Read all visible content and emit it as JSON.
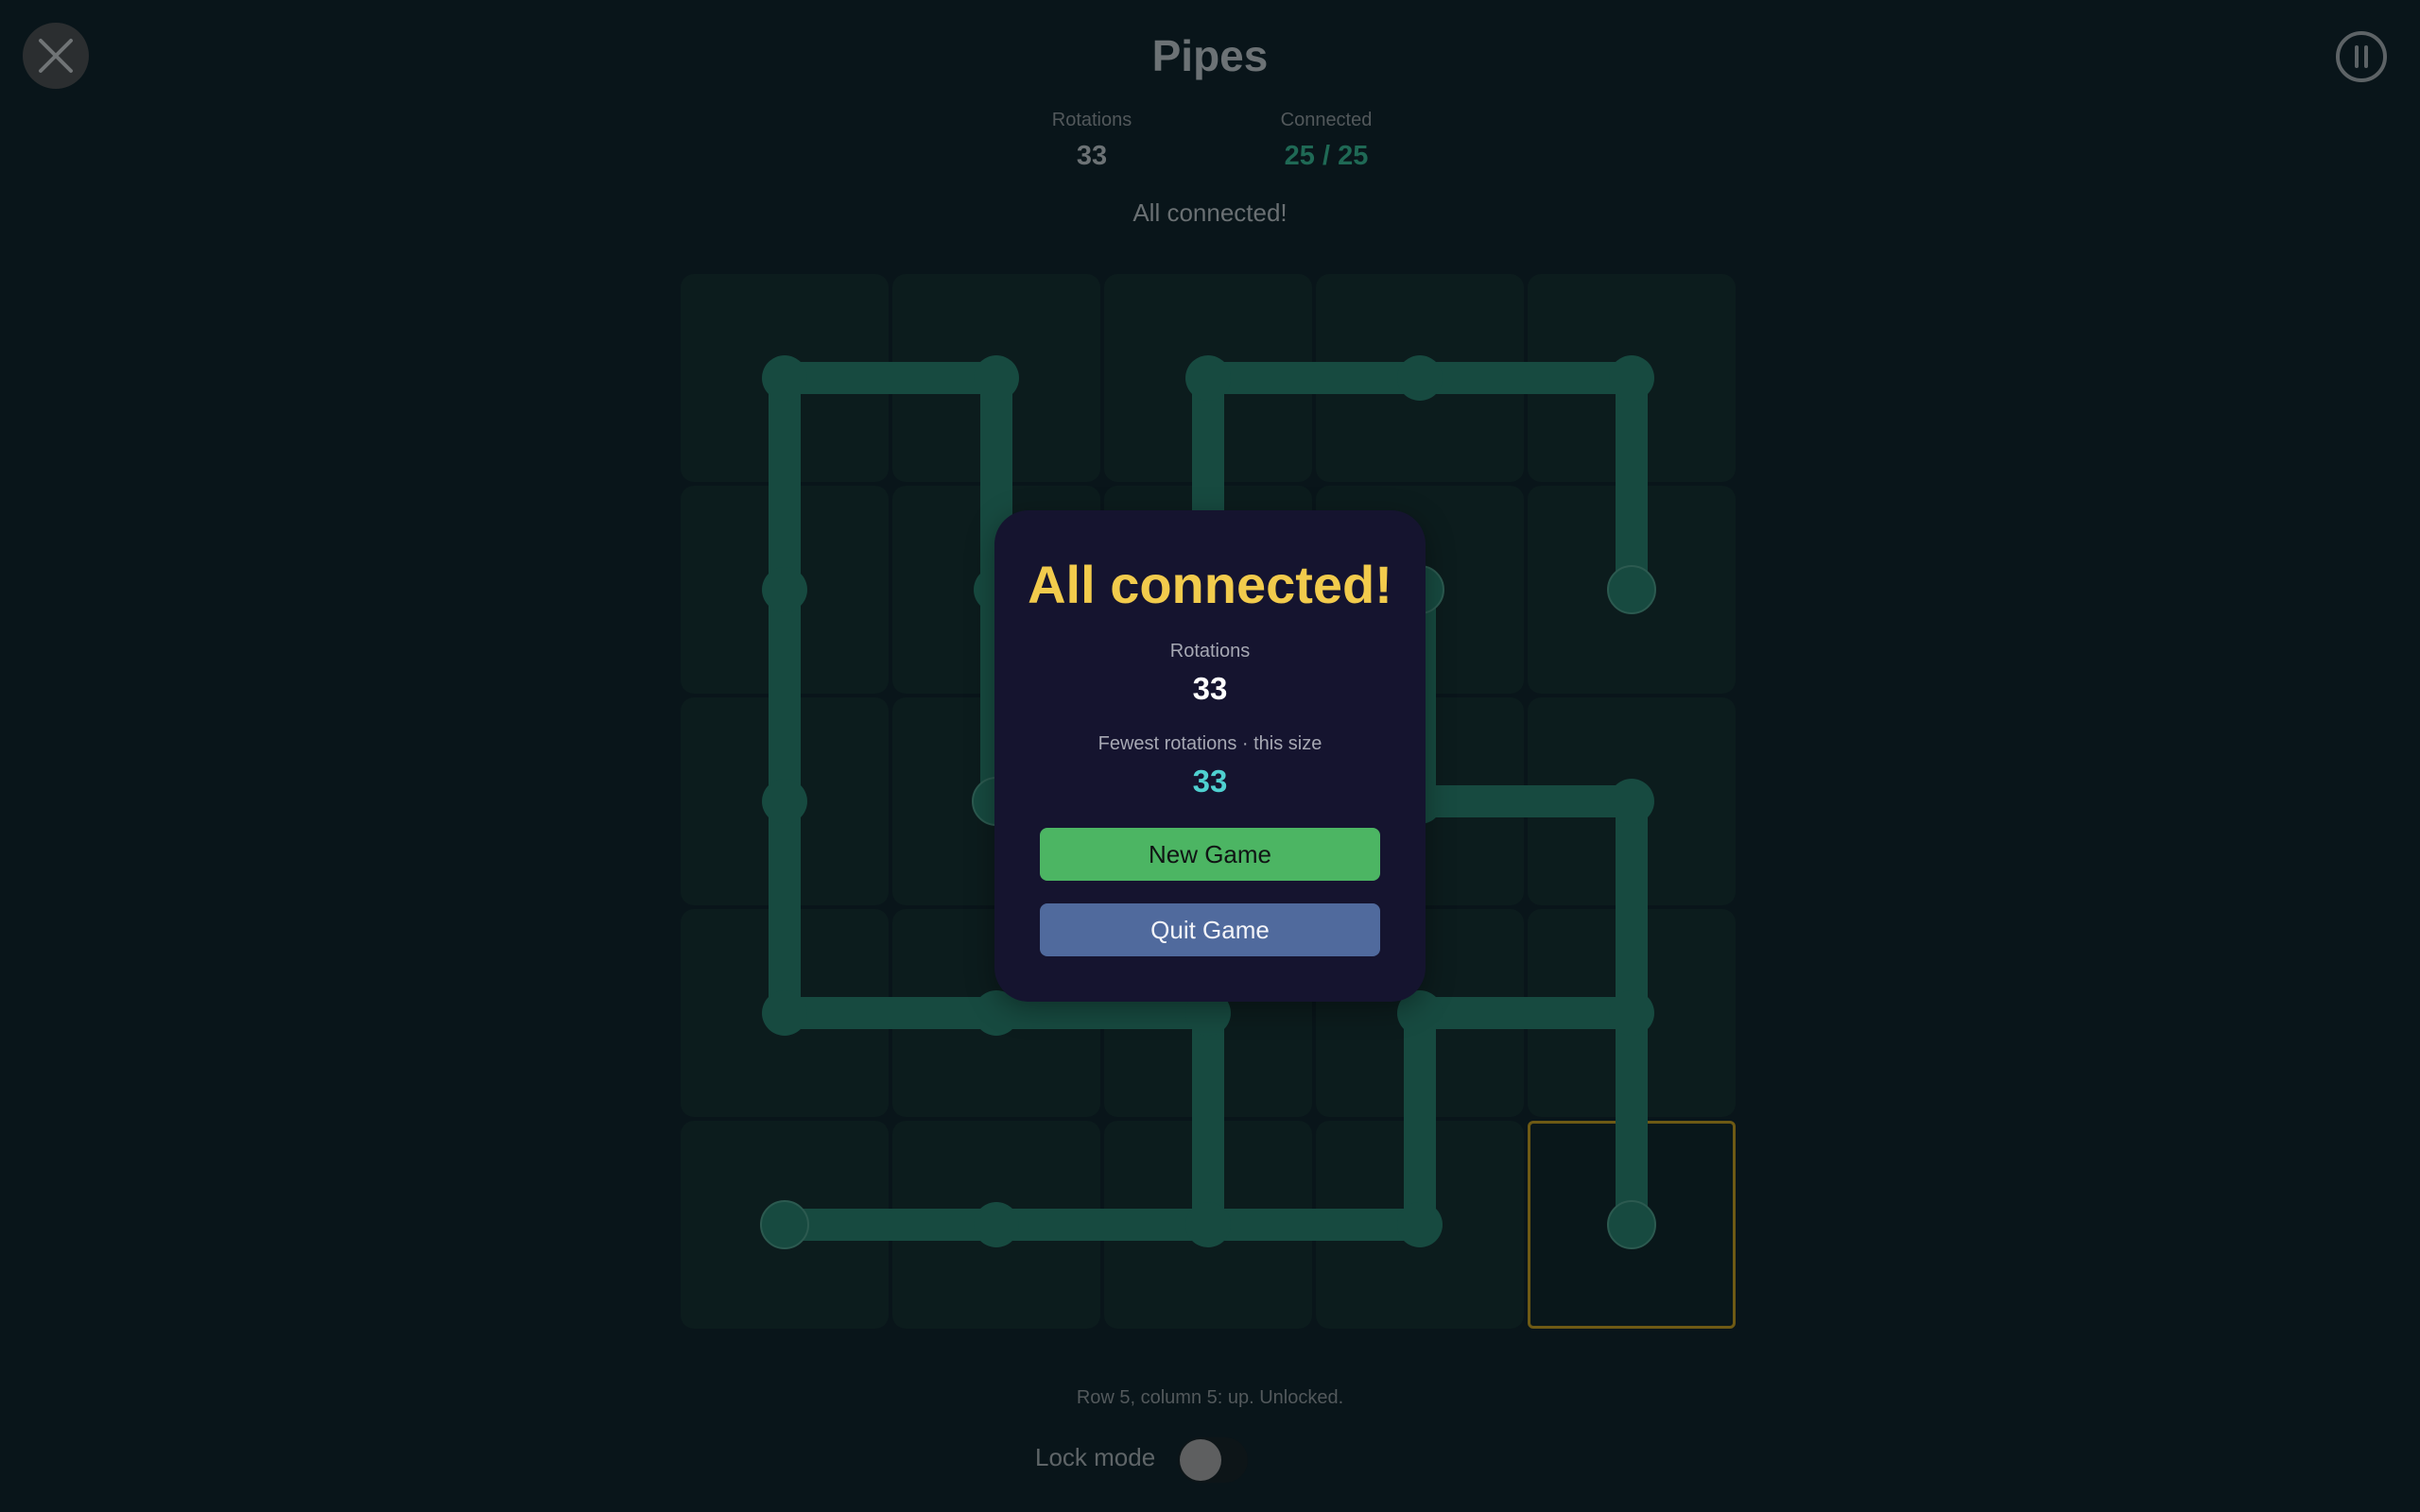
{
  "header": {
    "title": "Pipes",
    "rotations_label": "Rotations",
    "rotations_value": "33",
    "connected_label": "Connected",
    "connected_value": "25 / 25",
    "status": "All connected!"
  },
  "board": {
    "rows": 5,
    "cols": 5,
    "selected_cell": {
      "row": 5,
      "col": 5
    },
    "connected": true,
    "pipe_color": "#174a40",
    "cell_color": "#0c1c1d",
    "selected_outline_color": "#6e5a14",
    "cells": [
      [
        {
          "dirs": [
            "right",
            "down"
          ]
        },
        {
          "dirs": [
            "left",
            "down"
          ]
        },
        {
          "dirs": [
            "right",
            "down"
          ]
        },
        {
          "dirs": [
            "left",
            "right"
          ]
        },
        {
          "dirs": [
            "left",
            "down"
          ]
        }
      ],
      [
        {
          "dirs": [
            "up",
            "down"
          ]
        },
        {
          "dirs": [
            "up",
            "down"
          ]
        },
        {
          "dirs": [
            "up",
            "down"
          ]
        },
        {
          "dirs": [
            "down"
          ]
        },
        {
          "dirs": [
            "up"
          ]
        }
      ],
      [
        {
          "dirs": [
            "up",
            "down"
          ]
        },
        {
          "dirs": [
            "up"
          ]
        },
        {
          "dirs": [
            "up",
            "down"
          ]
        },
        {
          "dirs": [
            "up",
            "right"
          ]
        },
        {
          "dirs": [
            "left",
            "down"
          ]
        }
      ],
      [
        {
          "dirs": [
            "up",
            "right"
          ]
        },
        {
          "dirs": [
            "left",
            "right"
          ]
        },
        {
          "dirs": [
            "left",
            "down"
          ]
        },
        {
          "dirs": [
            "right",
            "down"
          ]
        },
        {
          "dirs": [
            "up",
            "left",
            "down"
          ]
        }
      ],
      [
        {
          "dirs": [
            "right"
          ]
        },
        {
          "dirs": [
            "left",
            "right"
          ]
        },
        {
          "dirs": [
            "up",
            "left",
            "right"
          ]
        },
        {
          "dirs": [
            "up",
            "left"
          ]
        },
        {
          "dirs": [
            "up"
          ]
        }
      ]
    ]
  },
  "footer": {
    "cell_info": "Row 5, column 5: up. Unlocked.",
    "lock_mode_label": "Lock mode",
    "lock_mode_on": false
  },
  "modal": {
    "title": "All connected!",
    "rotations_label": "Rotations",
    "rotations_value": "33",
    "best_label": "Fewest rotations · this size",
    "best_value": "33",
    "new_game_label": "New Game",
    "quit_game_label": "Quit Game",
    "title_color": "#f2cb4c",
    "best_color": "#4fd0d0"
  },
  "icons": {
    "close": "close-icon",
    "pause": "pause-icon"
  }
}
